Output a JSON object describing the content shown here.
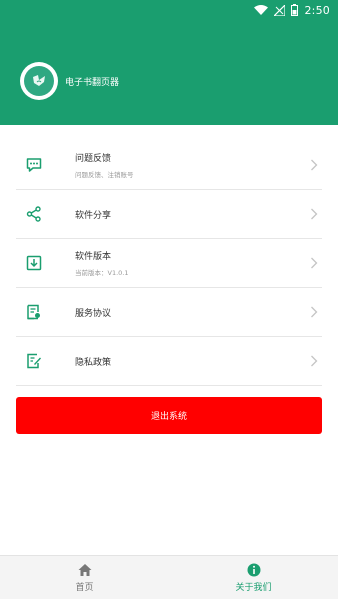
{
  "status_bar": {
    "time": "2:50"
  },
  "app": {
    "name": "电子书翻页器"
  },
  "menu": [
    {
      "title": "问题反馈",
      "subtitle": "问题反馈、注销账号",
      "icon": "chat-bubble-icon"
    },
    {
      "title": "软件分享",
      "subtitle": "",
      "icon": "share-icon"
    },
    {
      "title": "软件版本",
      "subtitle": "当前版本：V1.0.1",
      "icon": "download-icon"
    },
    {
      "title": "服务协议",
      "subtitle": "",
      "icon": "document-badge-icon"
    },
    {
      "title": "隐私政策",
      "subtitle": "",
      "icon": "edit-document-icon"
    }
  ],
  "logout_label": "退出系统",
  "tabs": [
    {
      "label": "首页",
      "icon": "home-icon",
      "active": false
    },
    {
      "label": "关于我们",
      "icon": "info-icon",
      "active": true
    }
  ],
  "colors": {
    "primary": "#1a9e6f",
    "danger": "#ff0000",
    "tab_bg": "#f4f4f4"
  }
}
